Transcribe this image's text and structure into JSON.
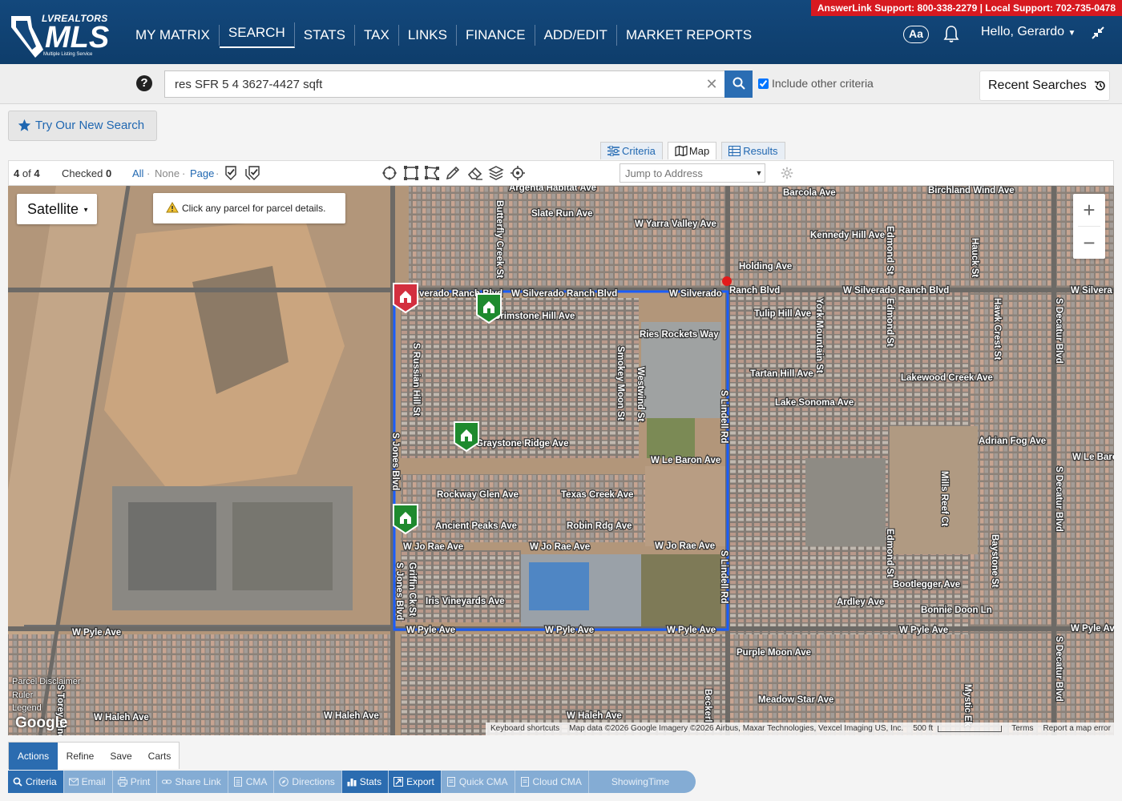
{
  "header": {
    "support_text": "AnswerLink Support: 800-338-2279 | Local Support: 702-735-0478",
    "logo_top": "LVREALTORS",
    "logo_main": "MLS",
    "logo_sub": "Multiple Listing Service",
    "nav": [
      "MY MATRIX",
      "SEARCH",
      "STATS",
      "TAX",
      "LINKS",
      "FINANCE",
      "ADD/EDIT",
      "MARKET REPORTS"
    ],
    "active_nav": "SEARCH",
    "font_size_button": "Aa",
    "greeting": "Hello, Gerardo"
  },
  "search": {
    "query": "res SFR 5 4 3627-4427 sqft",
    "include_other_label": "Include other criteria",
    "include_other_checked": true,
    "recent_label": "Recent Searches"
  },
  "try_new_label": "Try Our New Search",
  "view_tabs": {
    "criteria": "Criteria",
    "map": "Map",
    "results": "Results",
    "active": "Map"
  },
  "toolbar": {
    "count_current": "4",
    "count_of": "of",
    "count_total": "4",
    "checked_label": "Checked",
    "checked_count": "0",
    "all": "All",
    "none": "None",
    "page": "Page",
    "jump_placeholder": "Jump to Address"
  },
  "map": {
    "type_label": "Satellite",
    "hint": "Click any parcel for parcel details.",
    "overlay_labels": [
      "Parcel Disclaimer",
      "Ruler",
      "Legend"
    ],
    "google": "Google",
    "attribution": [
      "Keyboard shortcuts",
      "Map data ©2026 Google Imagery ©2026 Airbus, Maxar Technologies, Vexcel Imaging US, Inc.",
      "500 ft",
      "Terms",
      "Report a map error"
    ],
    "streets": {
      "argenta": "Argenta Habitat Ave",
      "barcola": "Barcola Ave",
      "birchland": "Birchland Wind Ave",
      "slate": "Slate Run Ave",
      "yarra": "W Yarra Valley Ave",
      "kennedy": "Kennedy Hill Ave",
      "holding": "Holding Ave",
      "silverado_a": "verado Ranch Blvd",
      "silverado_b": "W Silverado Ranch Blvd",
      "silverado_c": "W Silverado",
      "silverado_d": "Ranch Blvd",
      "silverado_e": "W Silverado Ranch Blvd",
      "silverado_f": "W Silvera",
      "brimstone": "Brimstone Hill Ave",
      "ries": "Ries Rockets Way",
      "tulip": "Tulip Hill Ave",
      "tartan": "Tartan Hill Ave",
      "lakewood": "Lakewood Creek Ave",
      "sonoma": "Lake Sonoma Ave",
      "graystone": "Graystone Ridge Ave",
      "lebaron": "W Le Baron Ave",
      "lebaron2": "W Le Baro",
      "adrian": "Adrian Fog Ave",
      "rockway": "Rockway Glen Ave",
      "texas": "Texas Creek Ave",
      "ancient": "Ancient Peaks Ave",
      "robin": "Robin Rdg Ave",
      "jorae1": "W Jo Rae Ave",
      "jorae2": "W Jo Rae Ave",
      "jorae3": "W Jo Rae Ave",
      "bootlegger": "Bootlegger Ave",
      "iris": "Iris Vineyards Ave",
      "ardley": "Ardley Ave",
      "bonnie": "Bonnie Doon Ln",
      "pyle1": "W Pyle Ave",
      "pyle2": "W Pyle Ave",
      "pyle3": "W Pyle Ave",
      "pyle4": "W Pyle Ave",
      "pyle5": "W Pyle Ave",
      "pyle6": "W Pyle Av",
      "purple": "Purple Moon Ave",
      "meadow": "Meadow Star Ave",
      "haleh1": "W Haleh Ave",
      "haleh2": "W Haleh Ave",
      "haleh3": "W Haleh Ave",
      "butterfly": "Butterfly Creek St",
      "russian": "S Russian Hill St",
      "smokey": "Smokey Moon St",
      "westwind": "Westwind St",
      "lindell1": "S Lindell Rd",
      "lindell2": "S Lindell Rd",
      "york": "York Mountain St",
      "edmond1": "Edmond St",
      "edmond2": "Edmond St",
      "edmond3": "Edmond St",
      "hauck": "Hauck St",
      "hawk": "Hawk Crest St",
      "decatur1": "S Decatur Blvd",
      "decatur2": "S Decatur Blvd",
      "decatur3": "S Decatur Blvd",
      "mills": "Mills Reef Ct",
      "baystone": "Baystone St",
      "jones1": "S Jones Blvd",
      "jones2": "S Jones Blvd",
      "griffin": "Griffin Ck St",
      "beckerl": "Beckerl",
      "mystic": "Mystic Ek",
      "torey": "S Torey Pine"
    }
  },
  "actions": {
    "tabs": [
      "Actions",
      "Refine",
      "Save",
      "Carts"
    ],
    "active_tab": "Actions",
    "buttons": [
      "Criteria",
      "Email",
      "Print",
      "Share Link",
      "CMA",
      "Directions",
      "Stats",
      "Export",
      "Quick CMA",
      "Cloud CMA",
      "ShowingTime"
    ],
    "highlighted": [
      "Criteria",
      "Stats",
      "Export"
    ]
  },
  "colors": {
    "header_bg": "#13487c",
    "support_bg": "#d71920",
    "accent": "#2a6db3",
    "boundary": "#1a5dff",
    "marker_green": "#1e8a2e",
    "marker_red": "#d32f3f"
  }
}
